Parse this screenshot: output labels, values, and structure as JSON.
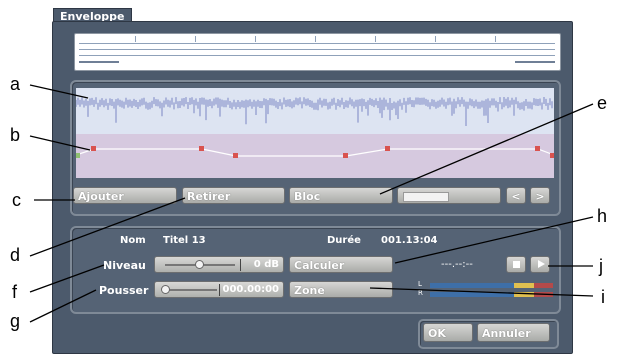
{
  "window": {
    "tab_label": "Enveloppe"
  },
  "envelope_controls": {
    "add_label": "Ajouter",
    "remove_label": "Retirer",
    "block_label": "Bloc",
    "prev_symbol": "<",
    "next_symbol": ">"
  },
  "info": {
    "name_label": "Nom",
    "name_value": "Titel 13",
    "duration_label": "Durée",
    "duration_value": "001.13:04"
  },
  "level": {
    "label": "Niveau",
    "value": "0 dB"
  },
  "push": {
    "label": "Pousser",
    "value": "000.00:00"
  },
  "actions": {
    "calculate_label": "Calculer",
    "zone_label": "Zone",
    "timecode": "---.--:--",
    "meter_left": "L",
    "meter_right": "R"
  },
  "dialog": {
    "ok_label": "OK",
    "cancel_label": "Annuler"
  },
  "callouts": [
    "a",
    "b",
    "c",
    "d",
    "e",
    "f",
    "g",
    "h",
    "i",
    "j"
  ],
  "colors": {
    "window": "#4c5a6c",
    "waveform": "#7b86c4",
    "envelope_line": "#ffffff",
    "envelope_point": "#d9534f",
    "meter_l": "#e0c050",
    "meter_r": "#b34a4a"
  }
}
